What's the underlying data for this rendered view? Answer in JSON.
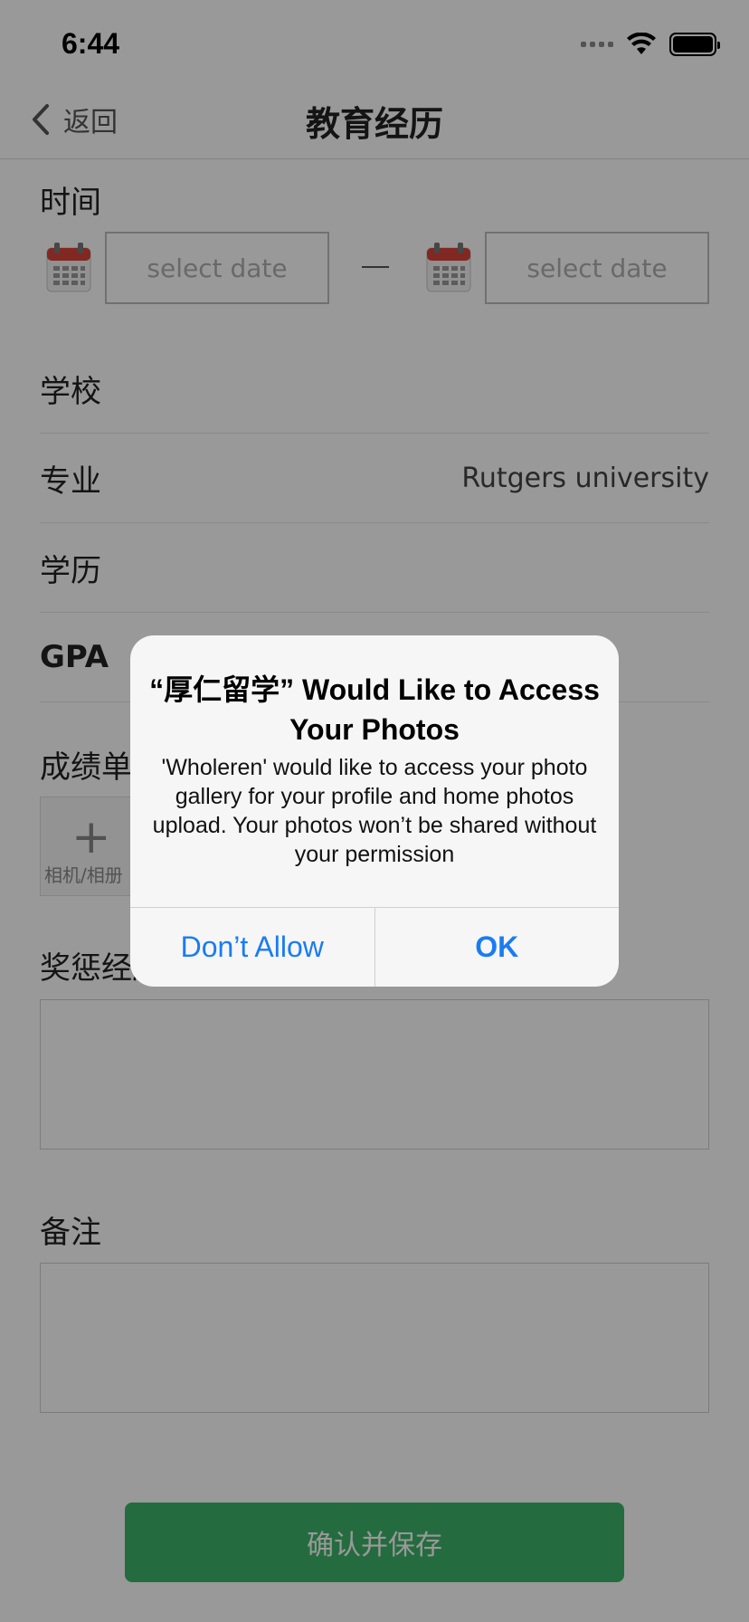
{
  "status_bar": {
    "time": "6:44"
  },
  "nav": {
    "back_label": "返回",
    "title": "教育经历"
  },
  "form": {
    "time_label": "时间",
    "start_date_placeholder": "select date",
    "end_date_placeholder": "select date",
    "school_label": "学校",
    "school_value": "",
    "major_label": "专业",
    "major_value": "Rutgers university",
    "degree_label": "学历",
    "degree_value": "",
    "gpa_label": "GPA",
    "gpa_value": "",
    "transcript_label": "成绩单",
    "upload_caption": "相机/相册",
    "awards_label": "奖惩经历",
    "notes_label": "备注",
    "save_label": "确认并保存"
  },
  "alert": {
    "title": "“厚仁留学” Would Like to Access Your Photos",
    "message": "'Wholeren' would like to access your photo gallery for your profile and home photos upload. Your photos won’t be shared without your permission",
    "deny_label": "Don’t Allow",
    "ok_label": "OK"
  },
  "colors": {
    "save_button": "#3cb469",
    "alert_action": "#1a7cf2",
    "calendar_top": "#d9443a"
  }
}
